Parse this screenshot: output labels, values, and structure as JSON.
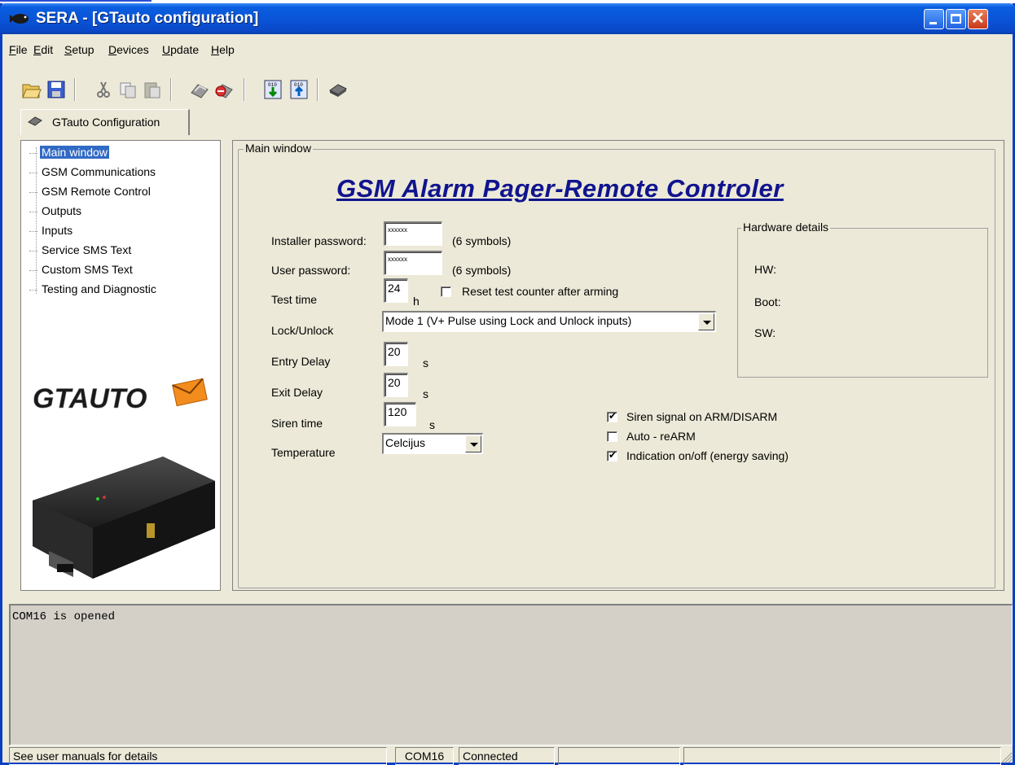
{
  "window": {
    "title": "SERA - [GTauto configuration]"
  },
  "menu": {
    "items": [
      {
        "label": "File",
        "accel": "F",
        "rest": "ile"
      },
      {
        "label": "Edit",
        "accel": "E",
        "rest": "dit"
      },
      {
        "label": "Setup",
        "accel": "S",
        "rest": "etup"
      },
      {
        "label": "Devices",
        "accel": "D",
        "rest": "evices"
      },
      {
        "label": "Update",
        "accel": "U",
        "rest": "pdate"
      },
      {
        "label": "Help",
        "accel": "H",
        "rest": "elp"
      }
    ]
  },
  "toolbar": {
    "icons": [
      "open-folder-icon",
      "save-icon",
      "cut-icon",
      "copy-icon",
      "paste-icon",
      "connect-icon",
      "disconnect-icon",
      "download-icon",
      "upload-icon",
      "device-icon"
    ]
  },
  "tab": {
    "label": "GTauto Configuration"
  },
  "tree": {
    "items": [
      "Main window",
      "GSM Communications",
      "GSM Remote Control",
      "Outputs",
      "Inputs",
      "Service SMS Text",
      "Custom SMS Text",
      "Testing and Diagnostic"
    ],
    "selected_index": 0
  },
  "logo": {
    "text": "GTAUTO"
  },
  "main": {
    "group_title": "Main window",
    "heading": "GSM Alarm Pager-Remote Controler",
    "installer_password": {
      "label": "Installer password:",
      "value": "xxxxxx",
      "hint": "(6 symbols)"
    },
    "user_password": {
      "label": "User password:",
      "value": "xxxxxx",
      "hint": "(6 symbols)"
    },
    "test_time": {
      "label": "Test time",
      "value": "24",
      "unit": "h"
    },
    "reset_counter": {
      "label": "Reset test counter after arming",
      "checked": false
    },
    "lock_unlock": {
      "label": "Lock/Unlock",
      "value": "Mode 1 (V+ Pulse using Lock and Unlock inputs)"
    },
    "entry_delay": {
      "label": "Entry Delay",
      "value": "20",
      "unit": "s"
    },
    "exit_delay": {
      "label": "Exit Delay",
      "value": "20",
      "unit": "s"
    },
    "siren_time": {
      "label": "Siren time",
      "value": "120",
      "unit": "s"
    },
    "temperature": {
      "label": "Temperature",
      "value": "Celcijus"
    },
    "siren_signal": {
      "label": "Siren signal on ARM/DISARM",
      "checked": true
    },
    "auto_rearm": {
      "label": "Auto - reARM",
      "checked": false
    },
    "indication": {
      "label": "Indication on/off (energy saving)",
      "checked": true
    },
    "hardware": {
      "title": "Hardware details",
      "hw_label": "HW:",
      "boot_label": "Boot:",
      "sw_label": "SW:"
    }
  },
  "log": {
    "text": "COM16 is opened"
  },
  "status": {
    "message": "See user manuals for details",
    "port": "COM16",
    "state": "Connected"
  }
}
